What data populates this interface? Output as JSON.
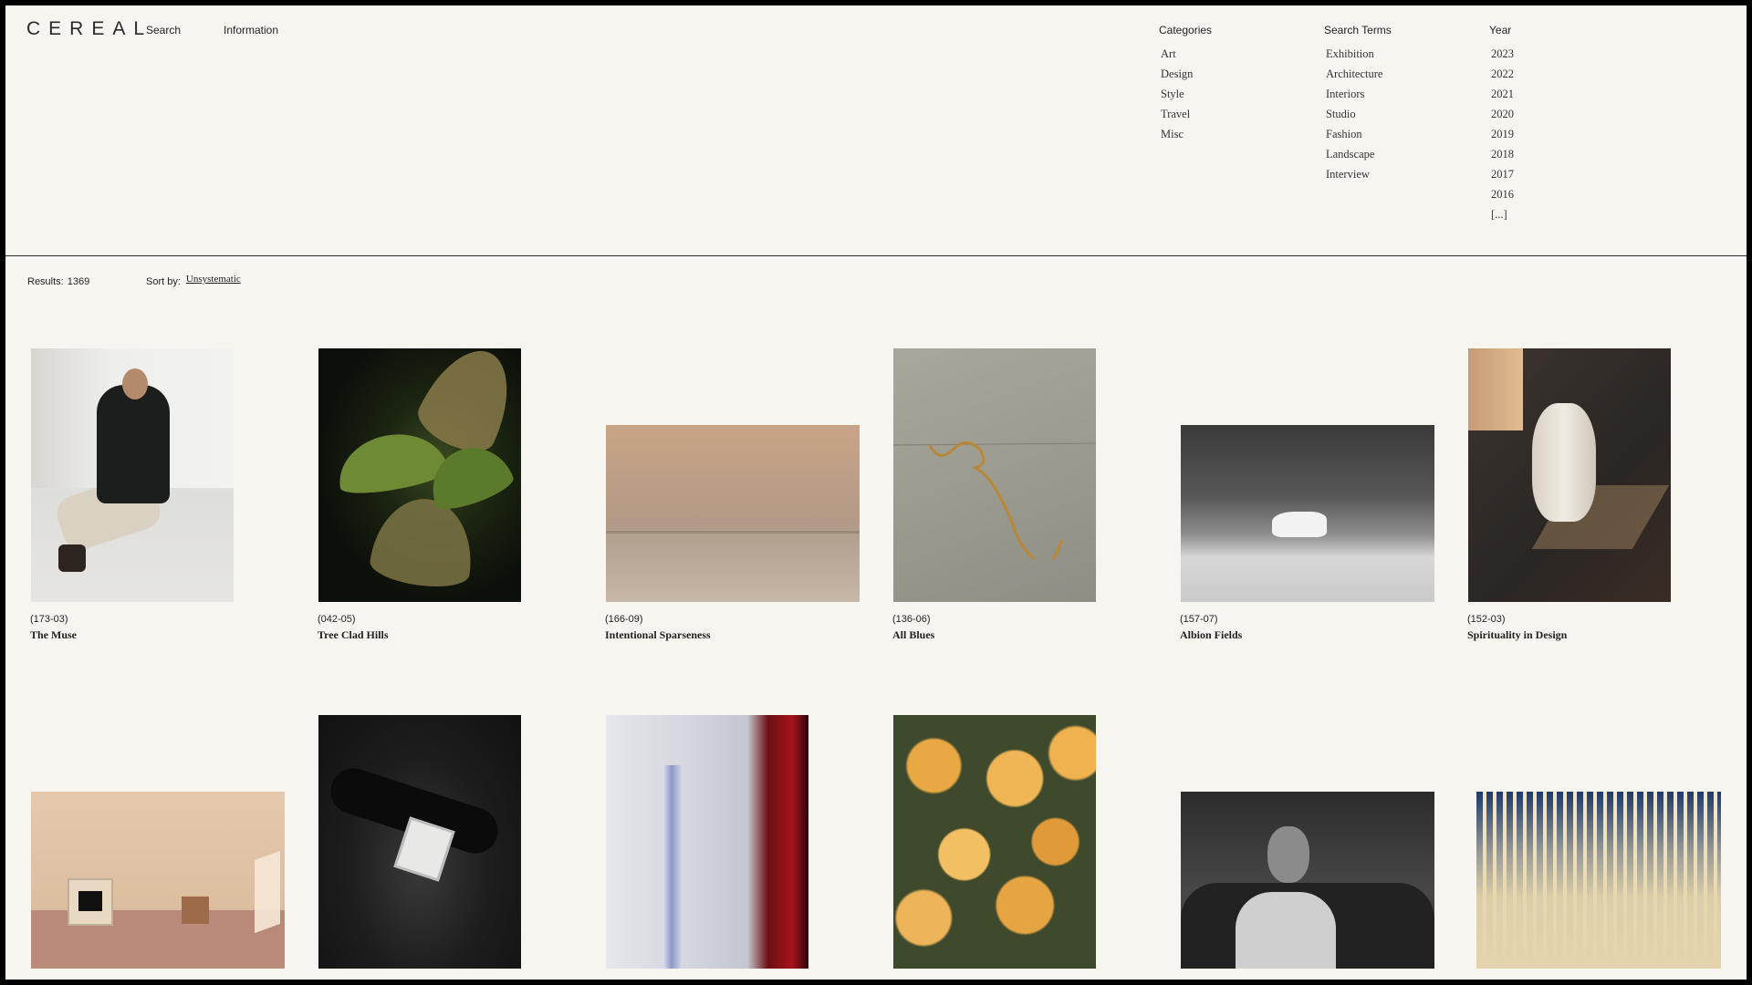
{
  "header": {
    "logo": "CEREAL",
    "nav": {
      "search": "Search",
      "information": "Information"
    }
  },
  "filters": {
    "categories": {
      "heading": "Categories",
      "items": [
        "Art",
        "Design",
        "Style",
        "Travel",
        "Misc"
      ]
    },
    "search_terms": {
      "heading": "Search Terms",
      "items": [
        "Exhibition",
        "Architecture",
        "Interiors",
        "Studio",
        "Fashion",
        "Landscape",
        "Interview"
      ]
    },
    "year": {
      "heading": "Year",
      "items": [
        "2023",
        "2022",
        "2021",
        "2020",
        "2019",
        "2018",
        "2017",
        "2016",
        "[...]"
      ]
    }
  },
  "results": {
    "label": "Results:",
    "count": "1369"
  },
  "sort": {
    "label": "Sort by:",
    "value": "Unsystematic"
  },
  "cards": [
    {
      "code": "(173-03)",
      "title": "The Muse"
    },
    {
      "code": "(042-05)",
      "title": "Tree Clad Hills"
    },
    {
      "code": "(166-09)",
      "title": "Intentional Sparseness"
    },
    {
      "code": "(136-06)",
      "title": "All Blues"
    },
    {
      "code": "(157-07)",
      "title": "Albion Fields"
    },
    {
      "code": "(152-03)",
      "title": "Spirituality in Design"
    }
  ],
  "colors": {
    "background": "#f7f5ef",
    "frame": "#000000",
    "text": "#1f1f1f"
  }
}
